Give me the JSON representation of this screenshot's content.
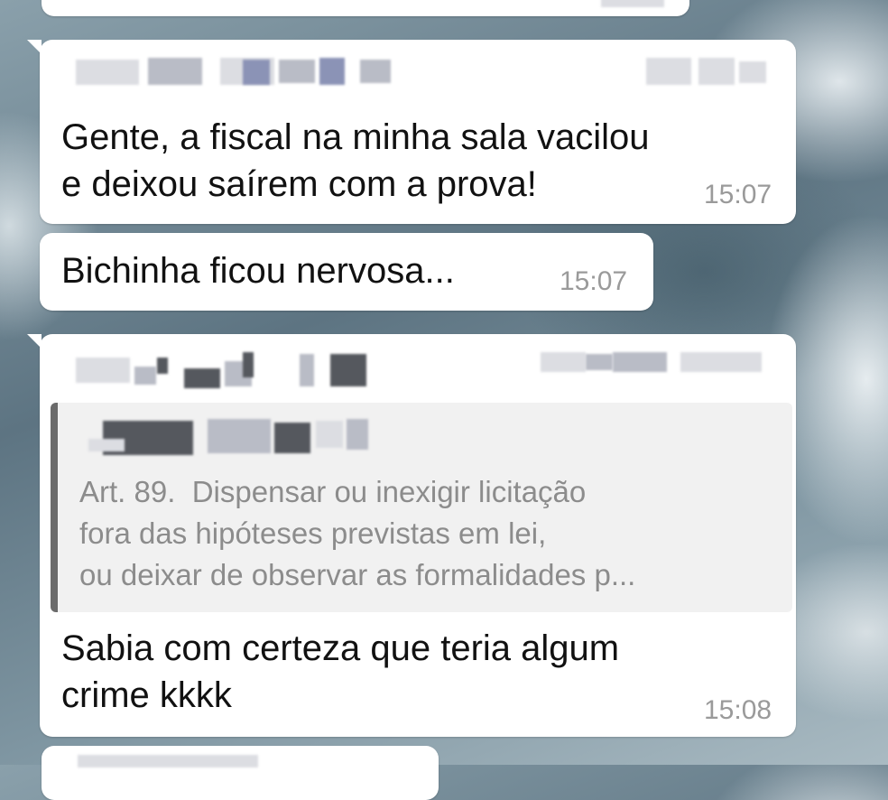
{
  "messages": [
    {
      "id": "msg1",
      "text_lines": [
        "Gente, a fiscal na minha sala vacilou",
        "e deixou saírem com a prova!"
      ],
      "time": "15:07"
    },
    {
      "id": "msg2",
      "text_lines": [
        "Bichinha ficou nervosa..."
      ],
      "time": "15:07"
    },
    {
      "id": "msg3",
      "quote": {
        "lines": [
          "Art. 89.  Dispensar ou inexigir licitação",
          "fora das hipóteses previstas em lei,",
          "ou deixar de observar as formalidades p..."
        ]
      },
      "text_lines": [
        "Sabia com certeza que teria algum",
        "crime kkkk"
      ],
      "time": "15:08"
    }
  ]
}
